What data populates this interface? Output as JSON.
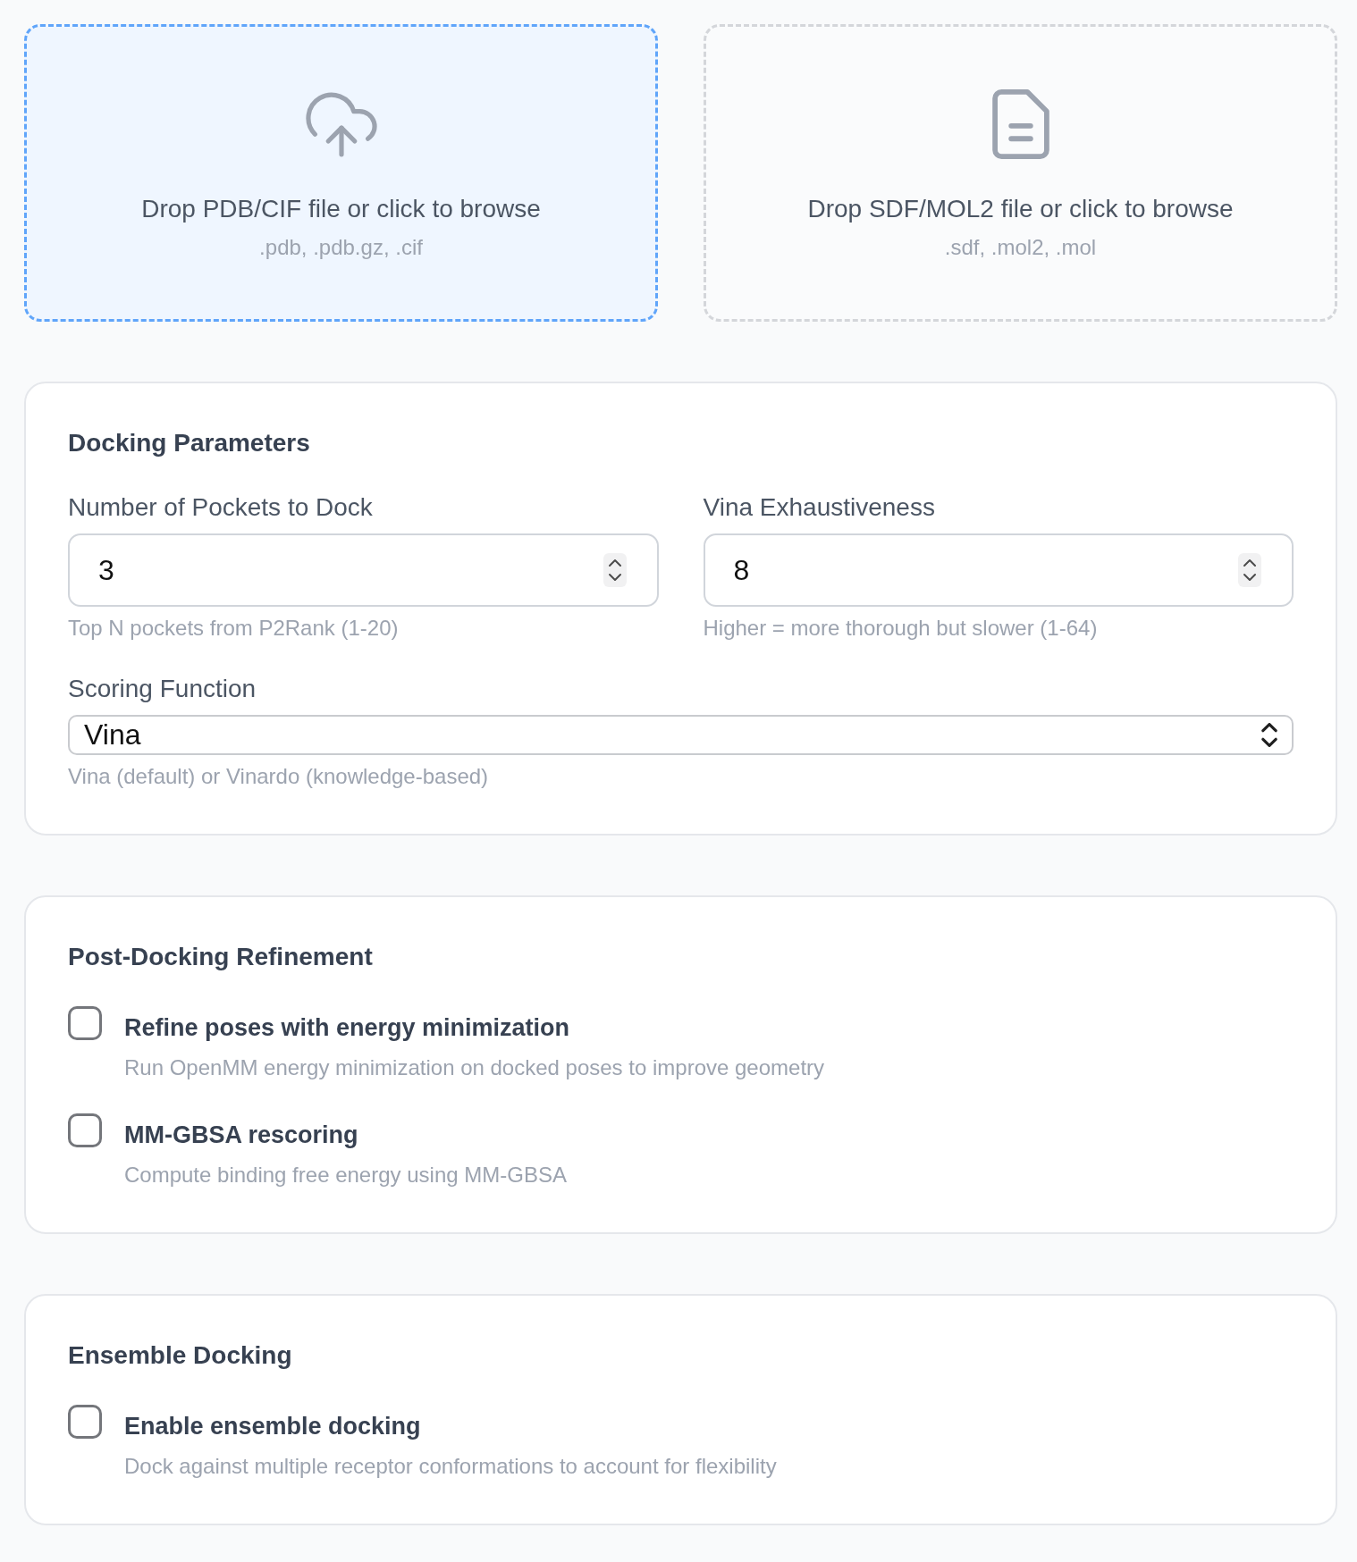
{
  "upload_zones": [
    {
      "kind": "structure",
      "prompt": "Drop PDB/CIF file or click to browse",
      "formats": ".pdb, .pdb.gz, .cif",
      "active": true
    },
    {
      "kind": "ligand",
      "prompt": "Drop SDF/MOL2 file or click to browse",
      "formats": ".sdf, .mol2, .mol",
      "active": false
    }
  ],
  "sections": [
    {
      "title": "Docking Parameters",
      "fields": [
        {
          "kind": "number",
          "label": "Number of Pockets to Dock",
          "value": "3",
          "help": "Top N pockets from P2Rank (1-20)"
        },
        {
          "kind": "number",
          "label": "Vina Exhaustiveness",
          "value": "8",
          "help": "Higher = more thorough but slower (1-64)"
        },
        {
          "kind": "select",
          "label": "Scoring Function",
          "value": "Vina",
          "help": "Vina (default) or Vinardo (knowledge-based)"
        }
      ]
    },
    {
      "title": "Post-Docking Refinement",
      "fields": [
        {
          "kind": "checkbox",
          "label": "Refine poses with energy minimization",
          "help": "Run OpenMM energy minimization on docked poses to improve geometry",
          "checked": false
        },
        {
          "kind": "checkbox",
          "label": "MM-GBSA rescoring",
          "help": "Compute binding free energy using MM-GBSA",
          "checked": false
        }
      ]
    },
    {
      "title": "Ensemble Docking",
      "fields": [
        {
          "kind": "checkbox",
          "label": "Enable ensemble docking",
          "help": "Dock against multiple receptor conformations to account for flexibility",
          "checked": false
        }
      ]
    }
  ]
}
